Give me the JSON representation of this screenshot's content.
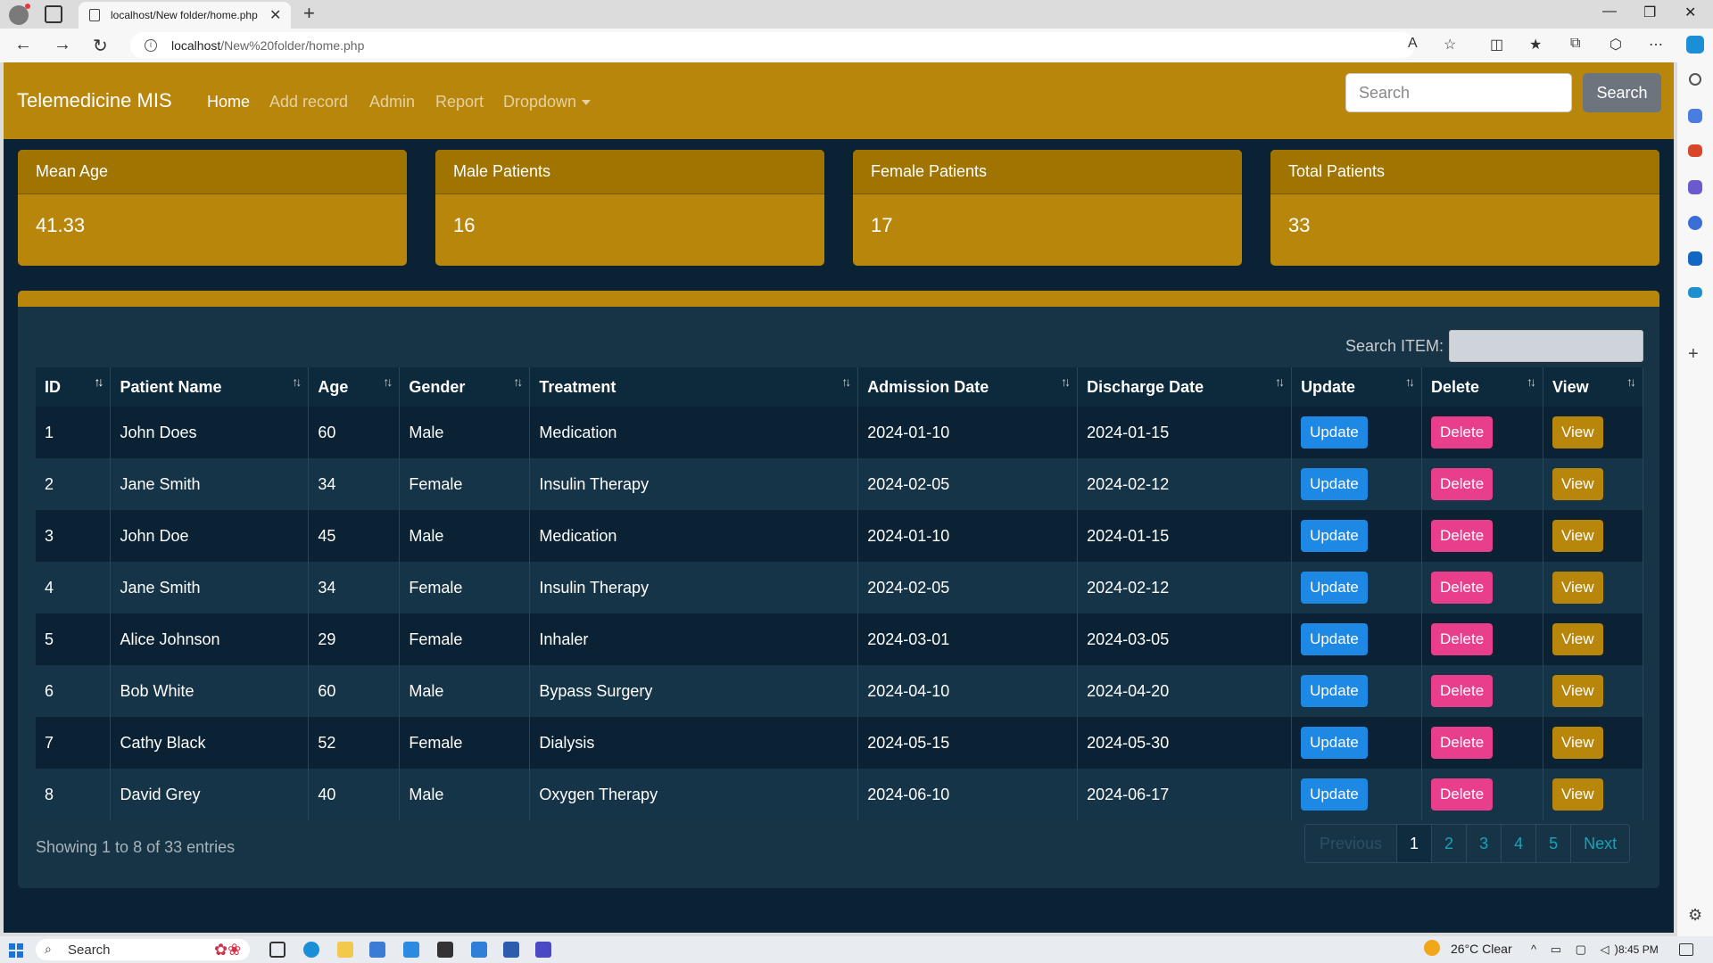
{
  "browser": {
    "tab_title": "localhost/New folder/home.php",
    "url_host": "localhost",
    "url_path": "/New%20folder/home.php"
  },
  "navbar": {
    "brand": "Telemedicine MIS",
    "links": [
      "Home",
      "Add record",
      "Admin",
      "Report"
    ],
    "dropdown_label": "Dropdown",
    "search_placeholder": "Search",
    "search_button": "Search"
  },
  "stats": [
    {
      "label": "Mean Age",
      "value": "41.33"
    },
    {
      "label": "Male Patients",
      "value": "16"
    },
    {
      "label": "Female Patients",
      "value": "17"
    },
    {
      "label": "Total Patients",
      "value": "33"
    }
  ],
  "table": {
    "search_label": "Search ITEM:",
    "columns": [
      "ID",
      "Patient Name",
      "Age",
      "Gender",
      "Treatment",
      "Admission Date",
      "Discharge Date",
      "Update",
      "Delete",
      "View"
    ],
    "action_labels": {
      "update": "Update",
      "delete": "Delete",
      "view": "View"
    },
    "rows": [
      {
        "id": "1",
        "name": "John Does",
        "age": "60",
        "gender": "Male",
        "treatment": "Medication",
        "admission": "2024-01-10",
        "discharge": "2024-01-15"
      },
      {
        "id": "2",
        "name": "Jane Smith",
        "age": "34",
        "gender": "Female",
        "treatment": "Insulin Therapy",
        "admission": "2024-02-05",
        "discharge": "2024-02-12"
      },
      {
        "id": "3",
        "name": "John Doe",
        "age": "45",
        "gender": "Male",
        "treatment": "Medication",
        "admission": "2024-01-10",
        "discharge": "2024-01-15"
      },
      {
        "id": "4",
        "name": "Jane Smith",
        "age": "34",
        "gender": "Female",
        "treatment": "Insulin Therapy",
        "admission": "2024-02-05",
        "discharge": "2024-02-12"
      },
      {
        "id": "5",
        "name": "Alice Johnson",
        "age": "29",
        "gender": "Female",
        "treatment": "Inhaler",
        "admission": "2024-03-01",
        "discharge": "2024-03-05"
      },
      {
        "id": "6",
        "name": "Bob White",
        "age": "60",
        "gender": "Male",
        "treatment": "Bypass Surgery",
        "admission": "2024-04-10",
        "discharge": "2024-04-20"
      },
      {
        "id": "7",
        "name": "Cathy Black",
        "age": "52",
        "gender": "Female",
        "treatment": "Dialysis",
        "admission": "2024-05-15",
        "discharge": "2024-05-30"
      },
      {
        "id": "8",
        "name": "David Grey",
        "age": "40",
        "gender": "Male",
        "treatment": "Oxygen Therapy",
        "admission": "2024-06-10",
        "discharge": "2024-06-17"
      }
    ],
    "info": "Showing 1 to 8 of 33 entries",
    "pagination": {
      "previous": "Previous",
      "pages": [
        "1",
        "2",
        "3",
        "4",
        "5"
      ],
      "next": "Next",
      "active": "1"
    }
  },
  "taskbar": {
    "search": "Search",
    "weather": "26°C  Clear",
    "time": "8:45 PM"
  },
  "colors": {
    "brand_gold": "#b8860b",
    "page_bg": "#0a2233",
    "update_btn": "#1e88e5",
    "delete_btn": "#e83e8c",
    "view_btn": "#b8860b"
  }
}
